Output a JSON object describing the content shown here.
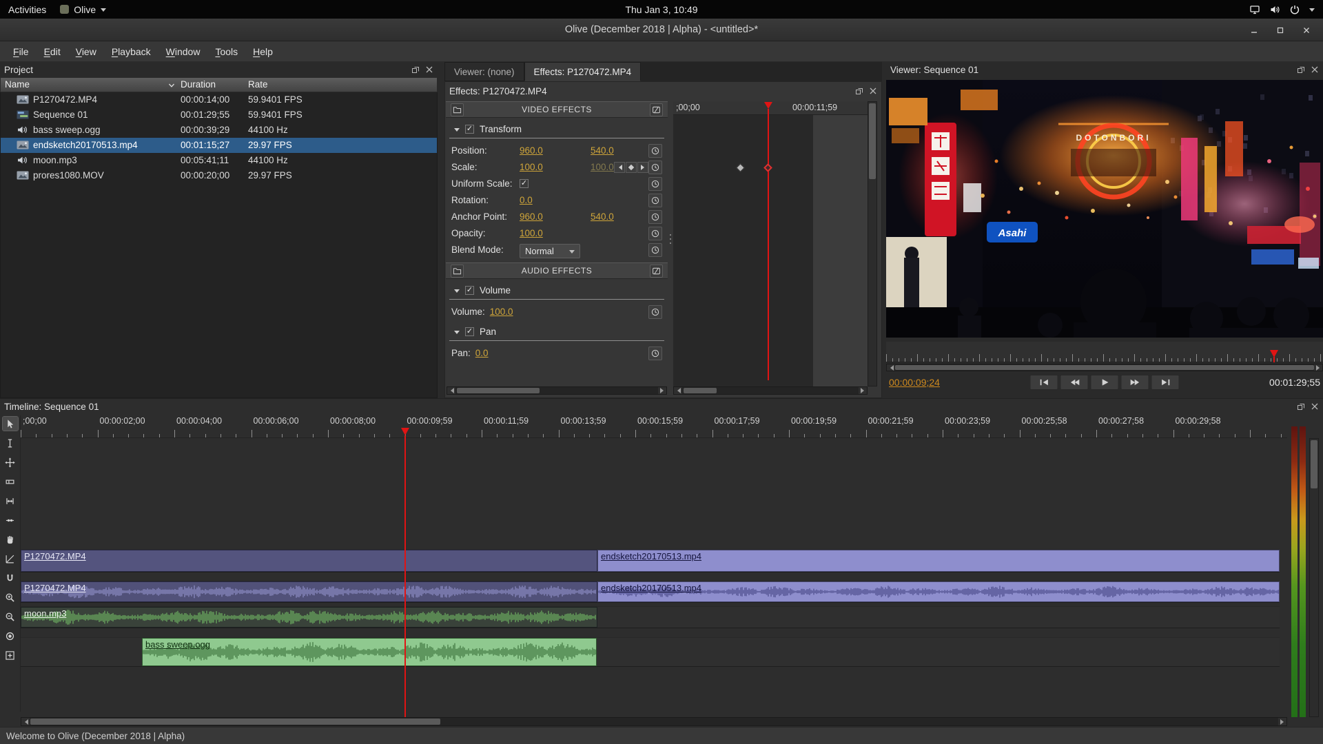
{
  "topbar": {
    "activities_label": "Activities",
    "app_name": "Olive",
    "clock": "Thu Jan 3, 10:49",
    "status_icons": [
      "network",
      "volume",
      "power"
    ]
  },
  "titlebar": {
    "title": "Olive (December 2018 | Alpha) - <untitled>*"
  },
  "menubar": {
    "items": [
      "File",
      "Edit",
      "View",
      "Playback",
      "Window",
      "Tools",
      "Help"
    ]
  },
  "project": {
    "title": "Project",
    "columns": [
      "Name",
      "Duration",
      "Rate"
    ],
    "items": [
      {
        "type": "video",
        "name": "P1270472.MP4",
        "duration": "00:00:14;00",
        "rate": "59.9401 FPS",
        "selected": false
      },
      {
        "type": "sequence",
        "name": "Sequence 01",
        "duration": "00:01:29;55",
        "rate": "59.9401 FPS",
        "selected": false
      },
      {
        "type": "audio",
        "name": "bass sweep.ogg",
        "duration": "00:00:39;29",
        "rate": "44100 Hz",
        "selected": false
      },
      {
        "type": "video",
        "name": "endsketch20170513.mp4",
        "duration": "00:01:15;27",
        "rate": "29.97 FPS",
        "selected": true
      },
      {
        "type": "audio",
        "name": "moon.mp3",
        "duration": "00:05:41;11",
        "rate": "44100 Hz",
        "selected": false
      },
      {
        "type": "video",
        "name": "prores1080.MOV",
        "duration": "00:00:20;00",
        "rate": "29.97 FPS",
        "selected": false
      }
    ]
  },
  "effects": {
    "tabs": [
      {
        "label": "Viewer: (none)",
        "active": false
      },
      {
        "label": "Effects: P1270472.MP4",
        "active": true
      }
    ],
    "panel_title": "Effects: P1270472.MP4",
    "video_effects_header": "VIDEO EFFECTS",
    "audio_effects_header": "AUDIO EFFECTS",
    "video_sections": [
      {
        "name": "Transform",
        "enabled": true,
        "rows": [
          {
            "label": "Position:",
            "type": "values",
            "values": [
              {
                "text": "960.0"
              },
              {
                "text": "540.0"
              }
            ]
          },
          {
            "label": "Scale:",
            "type": "values",
            "values": [
              {
                "text": "100.0"
              },
              {
                "text": "100.0",
                "dim": true
              }
            ],
            "keyframe_nav": true
          },
          {
            "label": "Uniform Scale:",
            "type": "checkbox",
            "checked": true
          },
          {
            "label": "Rotation:",
            "type": "values",
            "values": [
              {
                "text": "0.0"
              }
            ]
          },
          {
            "label": "Anchor Point:",
            "type": "values",
            "values": [
              {
                "text": "960.0"
              },
              {
                "text": "540.0"
              }
            ]
          },
          {
            "label": "Opacity:",
            "type": "values",
            "values": [
              {
                "text": "100.0"
              }
            ]
          },
          {
            "label": "Blend Mode:",
            "type": "dropdown",
            "value": "Normal"
          }
        ]
      }
    ],
    "audio_sections": [
      {
        "name": "Volume",
        "enabled": true,
        "rows": [
          {
            "label": "Volume:",
            "type": "inline",
            "value": "100.0"
          }
        ]
      },
      {
        "name": "Pan",
        "enabled": true,
        "rows": [
          {
            "label": "Pan:",
            "type": "inline",
            "value": "0.0"
          }
        ]
      }
    ],
    "keyframe_ruler": {
      "start_label": ";00;00",
      "end_label": "00:00:11;59"
    }
  },
  "viewer": {
    "title": "Viewer: Sequence 01",
    "timecode": "00:00:09;24",
    "duration": "00:01:29;55",
    "transport": [
      "go-to-start",
      "rewind",
      "play",
      "fast-forward",
      "go-to-end"
    ],
    "video_overlay": {
      "sign_text_1": "DOTONBORI",
      "sign_text_2": "Asahi"
    }
  },
  "timeline": {
    "title": "Timeline: Sequence 01",
    "ruler_labels": [
      ";00;00",
      "00:00:02;00",
      "00:00:04;00",
      "00:00:06;00",
      "00:00:08;00",
      "00:00:09;59",
      "00:00:11;59",
      "00:00:13;59",
      "00:00:15;59",
      "00:00:17;59",
      "00:00:19;59",
      "00:00:21;59",
      "00:00:23;59",
      "00:00:25;58",
      "00:00:27;58",
      "00:00:29;58"
    ],
    "tools": [
      "pointer",
      "edit",
      "ripple",
      "razor",
      "slip",
      "slide",
      "hand",
      "transition",
      "snap",
      "zoom-in",
      "zoom-out",
      "record",
      "add-track"
    ],
    "active_tool": "pointer",
    "playhead_fraction": 0.3054,
    "tracks": [
      {
        "kind": "video",
        "clips": [
          {
            "label": "P1270472.MP4",
            "start": 0,
            "width": 0.458,
            "style": "video-dark"
          },
          {
            "label": "endsketch20170513.mp4",
            "start": 0.458,
            "width": 0.542,
            "style": "video-light"
          }
        ]
      },
      {
        "kind": "audio",
        "clips": [
          {
            "label": "P1270472.MP4",
            "start": 0,
            "width": 0.458,
            "style": "audio-dark",
            "wave": true
          },
          {
            "label": "endsketch20170513.mp4",
            "start": 0.458,
            "width": 0.542,
            "style": "audio-light",
            "wave": true
          }
        ]
      },
      {
        "kind": "audio",
        "clips": [
          {
            "label": "moon.mp3",
            "start": 0,
            "width": 0.458,
            "style": "audio-green",
            "wave": true
          }
        ]
      },
      {
        "kind": "audio",
        "clips": [
          {
            "label": "bass sweep.ogg",
            "start": 0.0965,
            "width": 0.3615,
            "style": "audio-bass",
            "wave": true
          }
        ]
      }
    ]
  },
  "statusbar": {
    "message": "Welcome to Olive (December 2018 | Alpha)"
  }
}
